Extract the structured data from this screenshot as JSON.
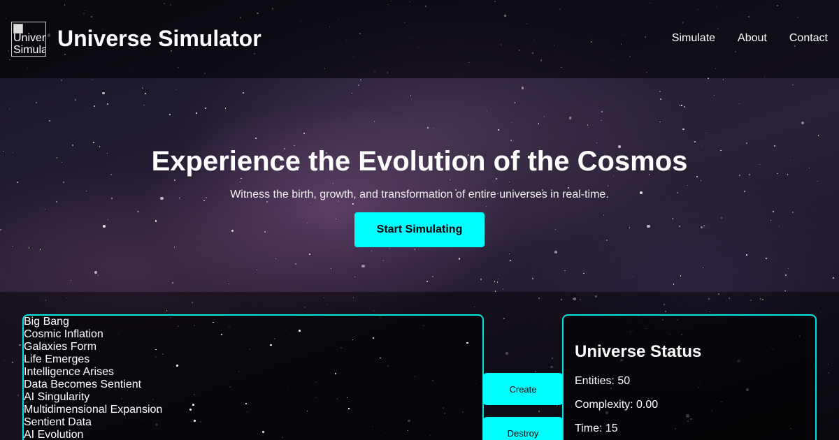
{
  "header": {
    "logo_alt": "Universe Simulator",
    "title": "Universe Simulator",
    "nav": [
      {
        "label": "Simulate"
      },
      {
        "label": "About"
      },
      {
        "label": "Contact"
      }
    ]
  },
  "hero": {
    "title": "Experience the Evolution of the Cosmos",
    "subtitle": "Witness the birth, growth, and transformation of entire universes in real-time.",
    "cta_label": "Start Simulating"
  },
  "stages": [
    "Big Bang",
    "Cosmic Inflation",
    "Galaxies Form",
    "Life Emerges",
    "Intelligence Arises",
    "Data Becomes Sentient",
    "AI Singularity",
    "Multidimensional Expansion",
    "Sentient Data",
    "AI Evolution"
  ],
  "controls": {
    "create_label": "Create",
    "destroy_label": "Destroy"
  },
  "status": {
    "title": "Universe Status",
    "entities": "Entities: 50",
    "complexity": "Complexity: 0.00",
    "time": "Time: 15"
  },
  "colors": {
    "accent": "#00ffff",
    "border": "#00e5e5"
  }
}
